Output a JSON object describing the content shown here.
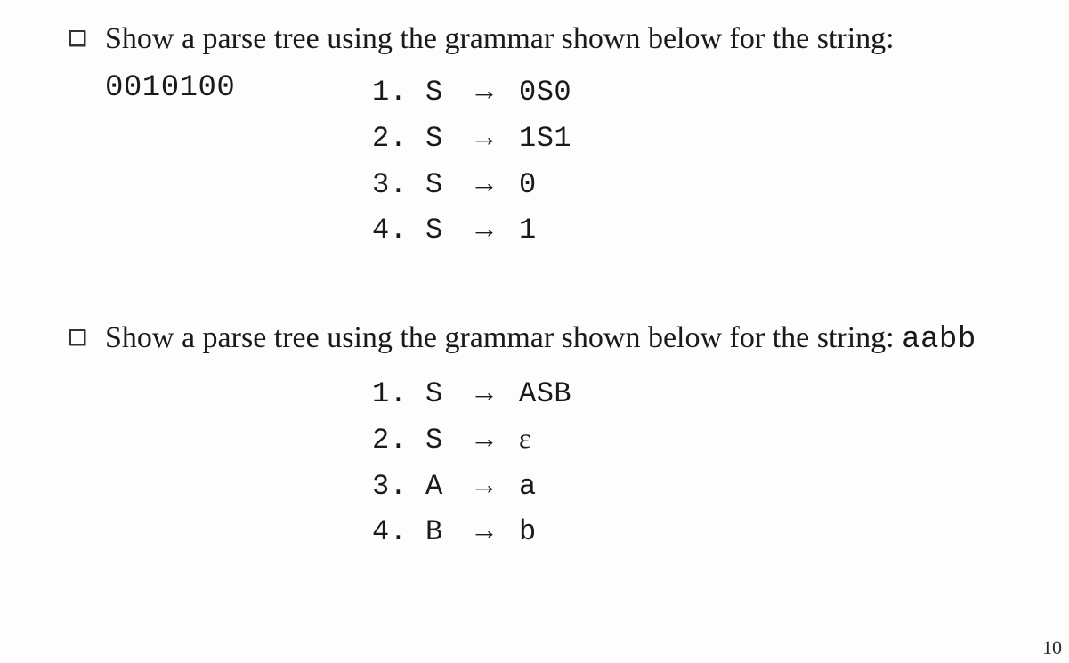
{
  "q1": {
    "prompt_prefix": "Show a parse tree using the grammar shown below for the string: ",
    "target_string": "0010100",
    "rules": [
      {
        "n": "1.",
        "lhs": "S",
        "arrow": "→",
        "rhs": "0S0"
      },
      {
        "n": "2.",
        "lhs": "S",
        "arrow": "→",
        "rhs": "1S1"
      },
      {
        "n": "3.",
        "lhs": "S",
        "arrow": "→",
        "rhs": "0"
      },
      {
        "n": "4.",
        "lhs": "S",
        "arrow": "→",
        "rhs": "1"
      }
    ]
  },
  "q2": {
    "prompt_prefix": "Show a parse tree using the grammar shown below for the string: ",
    "target_string": "aabb",
    "rules": [
      {
        "n": "1.",
        "lhs": "S",
        "arrow": "→",
        "rhs": "ASB"
      },
      {
        "n": "2.",
        "lhs": "S",
        "arrow": "→",
        "rhs": "ε"
      },
      {
        "n": "3.",
        "lhs": "A",
        "arrow": "→",
        "rhs": "a"
      },
      {
        "n": "4.",
        "lhs": "B",
        "arrow": "→",
        "rhs": "b"
      }
    ]
  },
  "page_number": "10"
}
